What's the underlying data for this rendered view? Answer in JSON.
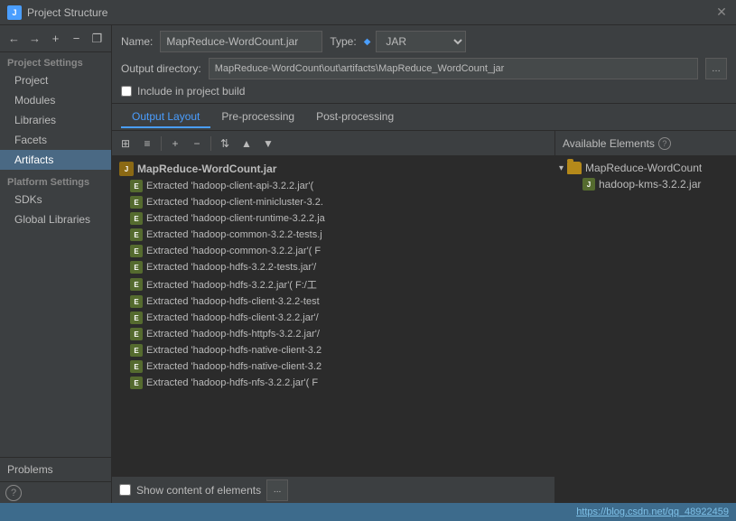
{
  "title_bar": {
    "icon": "J",
    "title": "Project Structure",
    "close_label": "✕"
  },
  "toolbar": {
    "add_label": "+",
    "remove_label": "−",
    "copy_label": "❐",
    "back_label": "←",
    "forward_label": "→"
  },
  "left_panel": {
    "project_settings_label": "Project Settings",
    "nav_items": [
      {
        "label": "Project",
        "active": false
      },
      {
        "label": "Modules",
        "active": false
      },
      {
        "label": "Libraries",
        "active": false
      },
      {
        "label": "Facets",
        "active": false
      },
      {
        "label": "Artifacts",
        "active": true
      }
    ],
    "platform_settings_label": "Platform Settings",
    "platform_items": [
      {
        "label": "SDKs",
        "active": false
      },
      {
        "label": "Global Libraries",
        "active": false
      }
    ],
    "problems_label": "Problems",
    "help_label": "?"
  },
  "artifact": {
    "name_label": "Name:",
    "name_value": "MapReduce-WordCount.jar",
    "type_label": "Type:",
    "type_diamond": "◆",
    "type_value": "JAR",
    "output_label": "Output directory:",
    "output_value": "MapReduce-WordCount\\out\\artifacts\\MapReduce_WordCount_jar",
    "include_label": "Include in project build"
  },
  "tabs": [
    {
      "label": "Output Layout",
      "active": true
    },
    {
      "label": "Pre-processing",
      "active": false
    },
    {
      "label": "Post-processing",
      "active": false
    }
  ],
  "content_toolbar": {
    "btn1": "⊞",
    "btn2": "⊟",
    "btn3": "+",
    "btn4": "−",
    "btn5": "⇅",
    "btn6": "▲",
    "btn7": "▼"
  },
  "tree_root": "MapReduce-WordCount.jar",
  "tree_items": [
    "Extracted 'hadoop-client-api-3.2.2.jar'(",
    "Extracted 'hadoop-client-minicluster-3.2.",
    "Extracted 'hadoop-client-runtime-3.2.2.ja",
    "Extracted 'hadoop-common-3.2.2-tests.j",
    "Extracted 'hadoop-common-3.2.2.jar'( F",
    "Extracted 'hadoop-hdfs-3.2.2-tests.jar'/",
    "Extracted 'hadoop-hdfs-3.2.2.jar'( F:/工",
    "Extracted 'hadoop-hdfs-client-3.2.2-test",
    "Extracted 'hadoop-hdfs-client-3.2.2.jar'/",
    "Extracted 'hadoop-hdfs-httpfs-3.2.2.jar'/",
    "Extracted 'hadoop-hdfs-native-client-3.2",
    "Extracted 'hadoop-hdfs-native-client-3.2",
    "Extracted 'hadoop-hdfs-nfs-3.2.2.jar'( F"
  ],
  "bottom": {
    "show_content_label": "Show content of elements",
    "dots_label": "..."
  },
  "available": {
    "header": "Available Elements",
    "help": "?",
    "group": "MapReduce-WordCount",
    "child": "hadoop-kms-3.2.2.jar"
  },
  "status_bar": {
    "link": "https://blog.csdn.net/qq_48922459"
  }
}
